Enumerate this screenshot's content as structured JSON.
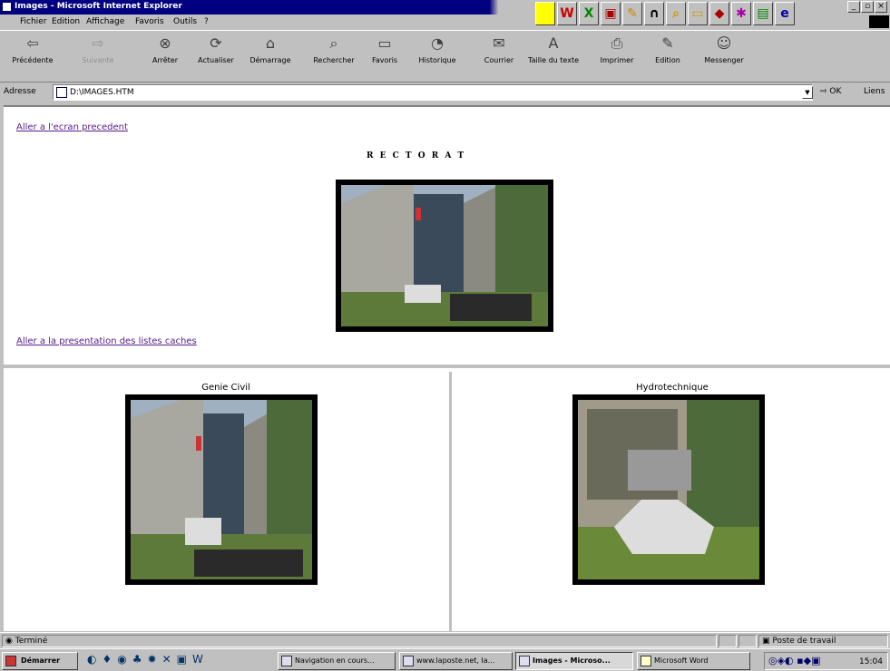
{
  "window": {
    "title": "Images - Microsoft Internet Explorer"
  },
  "menubar": [
    "Fichier",
    "Edition",
    "Affichage",
    "Favoris",
    "Outils",
    "?"
  ],
  "toolbar": {
    "buttons": [
      {
        "label": "Précédente",
        "icon": "back-arrow"
      },
      {
        "label": "Suivante",
        "icon": "forward-arrow"
      },
      {
        "label": "Arrêter",
        "icon": "stop"
      },
      {
        "label": "Actualiser",
        "icon": "refresh"
      },
      {
        "label": "Démarrage",
        "icon": "home"
      },
      {
        "label": "Rechercher",
        "icon": "search"
      },
      {
        "label": "Favoris",
        "icon": "favorites"
      },
      {
        "label": "Historique",
        "icon": "history"
      },
      {
        "label": "Courrier",
        "icon": "mail"
      },
      {
        "label": "Taille du texte",
        "icon": "text-size"
      },
      {
        "label": "Imprimer",
        "icon": "print"
      },
      {
        "label": "Edition",
        "icon": "edit"
      },
      {
        "label": "Messenger",
        "icon": "messenger"
      }
    ]
  },
  "address": {
    "label": "Adresse",
    "value": "D:\\IMAGES.HTM",
    "go": "OK",
    "links": "Liens"
  },
  "page": {
    "top_frame": {
      "back_link": "Aller a l'ecran precedent",
      "heading": "R E C T O R A T",
      "bottom_link": "Aller a la presentation des listes caches"
    },
    "left_frame": {
      "caption": "Genie Civil"
    },
    "right_frame": {
      "caption": "Hydrotechnique"
    }
  },
  "status": {
    "text": "Terminé",
    "zone": "Poste de travail"
  },
  "taskbar": {
    "start": "Démarrer",
    "tasks": [
      {
        "label": "Navigation en cours...",
        "active": false
      },
      {
        "label": "www.laposte.net, la...",
        "active": false
      },
      {
        "label": "Images - Microso...",
        "active": true
      },
      {
        "label": "Microsoft Word",
        "active": false
      }
    ],
    "clock": "15:04"
  }
}
